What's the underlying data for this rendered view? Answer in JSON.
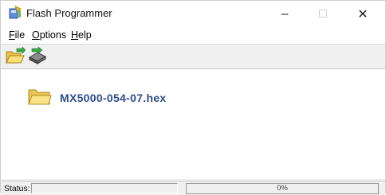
{
  "window": {
    "title": "Flash Programmer",
    "controls": {
      "minimize": "–",
      "maximize": "□",
      "close": "✕"
    }
  },
  "menu": {
    "file": {
      "accel": "F",
      "rest": "ile"
    },
    "options": {
      "accel": "O",
      "rest": "ptions"
    },
    "help": {
      "accel": "H",
      "rest": "elp"
    }
  },
  "toolbar": {
    "buttons": [
      {
        "name": "open-file-button",
        "icon": "folder-open-icon"
      },
      {
        "name": "program-button",
        "icon": "chip-program-icon"
      }
    ]
  },
  "content": {
    "file_name": "MX5000-054-07.hex",
    "file_icon": "folder-icon"
  },
  "status": {
    "label": "Status:",
    "text": "",
    "progress_percent": 0,
    "progress_text": "0%"
  },
  "colors": {
    "file_name": "#2f4d8a",
    "folder": "#f3d46a",
    "progress_fill": "#3c7fd6"
  }
}
